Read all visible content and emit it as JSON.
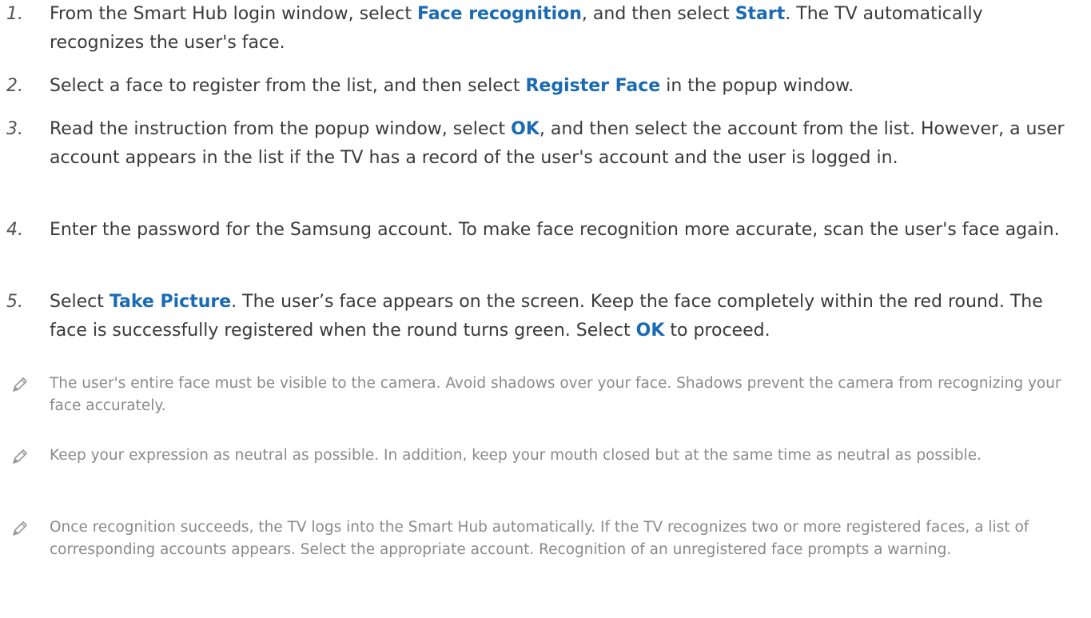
{
  "steps": [
    {
      "num": "1.",
      "parts": [
        "From the Smart Hub login window, select ",
        "Face recognition",
        ", and then select ",
        "Start",
        ". The TV automatically recognizes the user's face."
      ]
    },
    {
      "num": "2.",
      "parts": [
        "Select a face to register from the list, and then select ",
        "Register Face",
        " in the popup window."
      ]
    },
    {
      "num": "3.",
      "parts": [
        "Read the instruction from the popup window, select ",
        "OK",
        ", and then select the account from the list. However, a user account appears in the list if the TV has a record of the user's account and the user is logged in."
      ]
    },
    {
      "num": "4.",
      "parts": [
        "Enter the password for the Samsung account. To make face recognition more accurate, scan the user's face again."
      ]
    },
    {
      "num": "5.",
      "parts": [
        "Select ",
        "Take Picture",
        ". The user’s face appears on the screen. Keep the face completely within the red round. The face is successfully registered when the round turns green. Select ",
        "OK",
        " to proceed."
      ]
    }
  ],
  "notes": [
    {
      "icon": "pencil-icon",
      "text": "The user's entire face must be visible to the camera. Avoid shadows over your face. Shadows prevent the camera from recognizing your face accurately."
    },
    {
      "icon": "pencil-icon",
      "text": "Keep your expression as neutral as possible. In addition, keep your mouth closed but at the same time as neutral as possible."
    },
    {
      "icon": "pencil-icon",
      "text": "Once recognition succeeds, the TV logs into the Smart Hub automatically. If the TV recognizes two or more registered faces, a list of corresponding accounts appears. Select the appropriate account. Recognition of an unregistered face prompts a warning."
    }
  ],
  "colors": {
    "highlight": "#1a6bb3",
    "body_text": "#3a3a3a",
    "note_text": "#8a8a8a"
  }
}
